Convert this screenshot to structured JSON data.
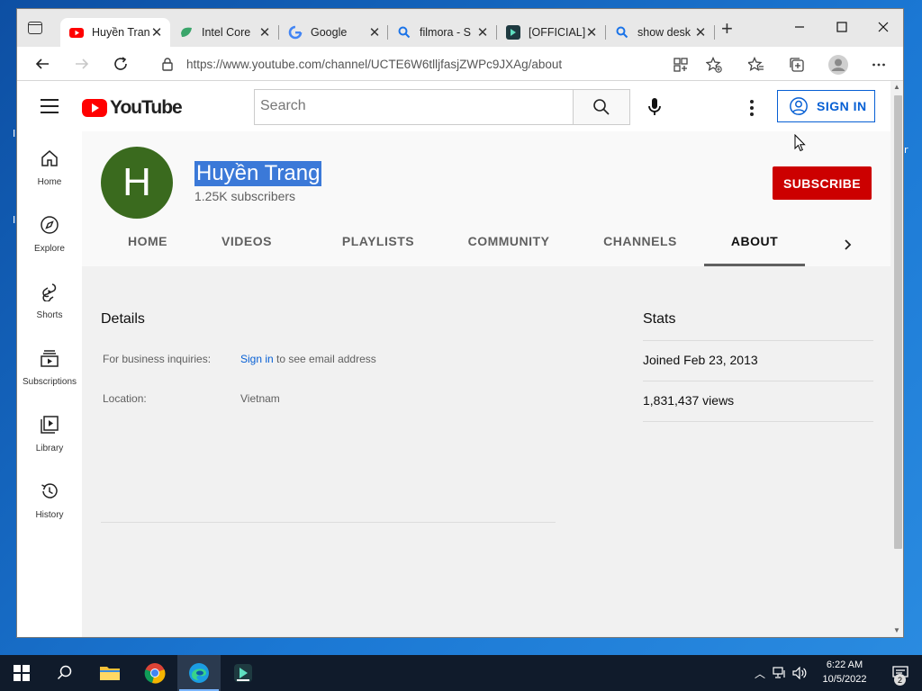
{
  "browser": {
    "tabs": [
      {
        "title": "Huyền Trang - YouTube",
        "favicon": "youtube-icon",
        "active": true
      },
      {
        "title": "Intel Core",
        "favicon": "leaf-icon",
        "active": false
      },
      {
        "title": "Google",
        "favicon": "google-icon",
        "active": false
      },
      {
        "title": "filmora - S",
        "favicon": "search-icon",
        "active": false
      },
      {
        "title": "[OFFICIAL]",
        "favicon": "filmora-icon",
        "active": false
      },
      {
        "title": "show desk",
        "favicon": "search-icon",
        "active": false
      }
    ],
    "url": "https://www.youtube.com/channel/UCTE6W6tlljfasjZWPc9JXAg/about"
  },
  "youtube": {
    "logo_text": "YouTube",
    "search_placeholder": "Search",
    "sign_in_label": "SIGN IN",
    "guide": [
      {
        "label": "Home",
        "icon": "home-icon"
      },
      {
        "label": "Explore",
        "icon": "compass-icon"
      },
      {
        "label": "Shorts",
        "icon": "shorts-icon"
      },
      {
        "label": "Subscriptions",
        "icon": "subscriptions-icon"
      },
      {
        "label": "Library",
        "icon": "library-icon"
      },
      {
        "label": "History",
        "icon": "history-icon"
      }
    ]
  },
  "channel": {
    "avatar_letter": "H",
    "name": "Huyền Trang",
    "subscribers": "1.25K subscribers",
    "subscribe_label": "SUBSCRIBE",
    "tabs": [
      {
        "label": "HOME",
        "selected": false
      },
      {
        "label": "VIDEOS",
        "selected": false
      },
      {
        "label": "PLAYLISTS",
        "selected": false
      },
      {
        "label": "COMMUNITY",
        "selected": false
      },
      {
        "label": "CHANNELS",
        "selected": false
      },
      {
        "label": "ABOUT",
        "selected": true
      }
    ],
    "about": {
      "details_title": "Details",
      "business_label": "For business inquiries:",
      "business_link": "Sign in",
      "business_suffix": " to see email address",
      "location_label": "Location:",
      "location_value": "Vietnam",
      "stats_title": "Stats",
      "joined": "Joined Feb 23, 2013",
      "views": "1,831,437 views"
    }
  },
  "taskbar": {
    "time": "6:22 AM",
    "date": "10/5/2022",
    "notification_count": "2"
  },
  "colors": {
    "yt_red": "#ff0000",
    "subscribe_red": "#cc0000",
    "link_blue": "#065fd4",
    "avatar_green": "#3a6a1e"
  }
}
